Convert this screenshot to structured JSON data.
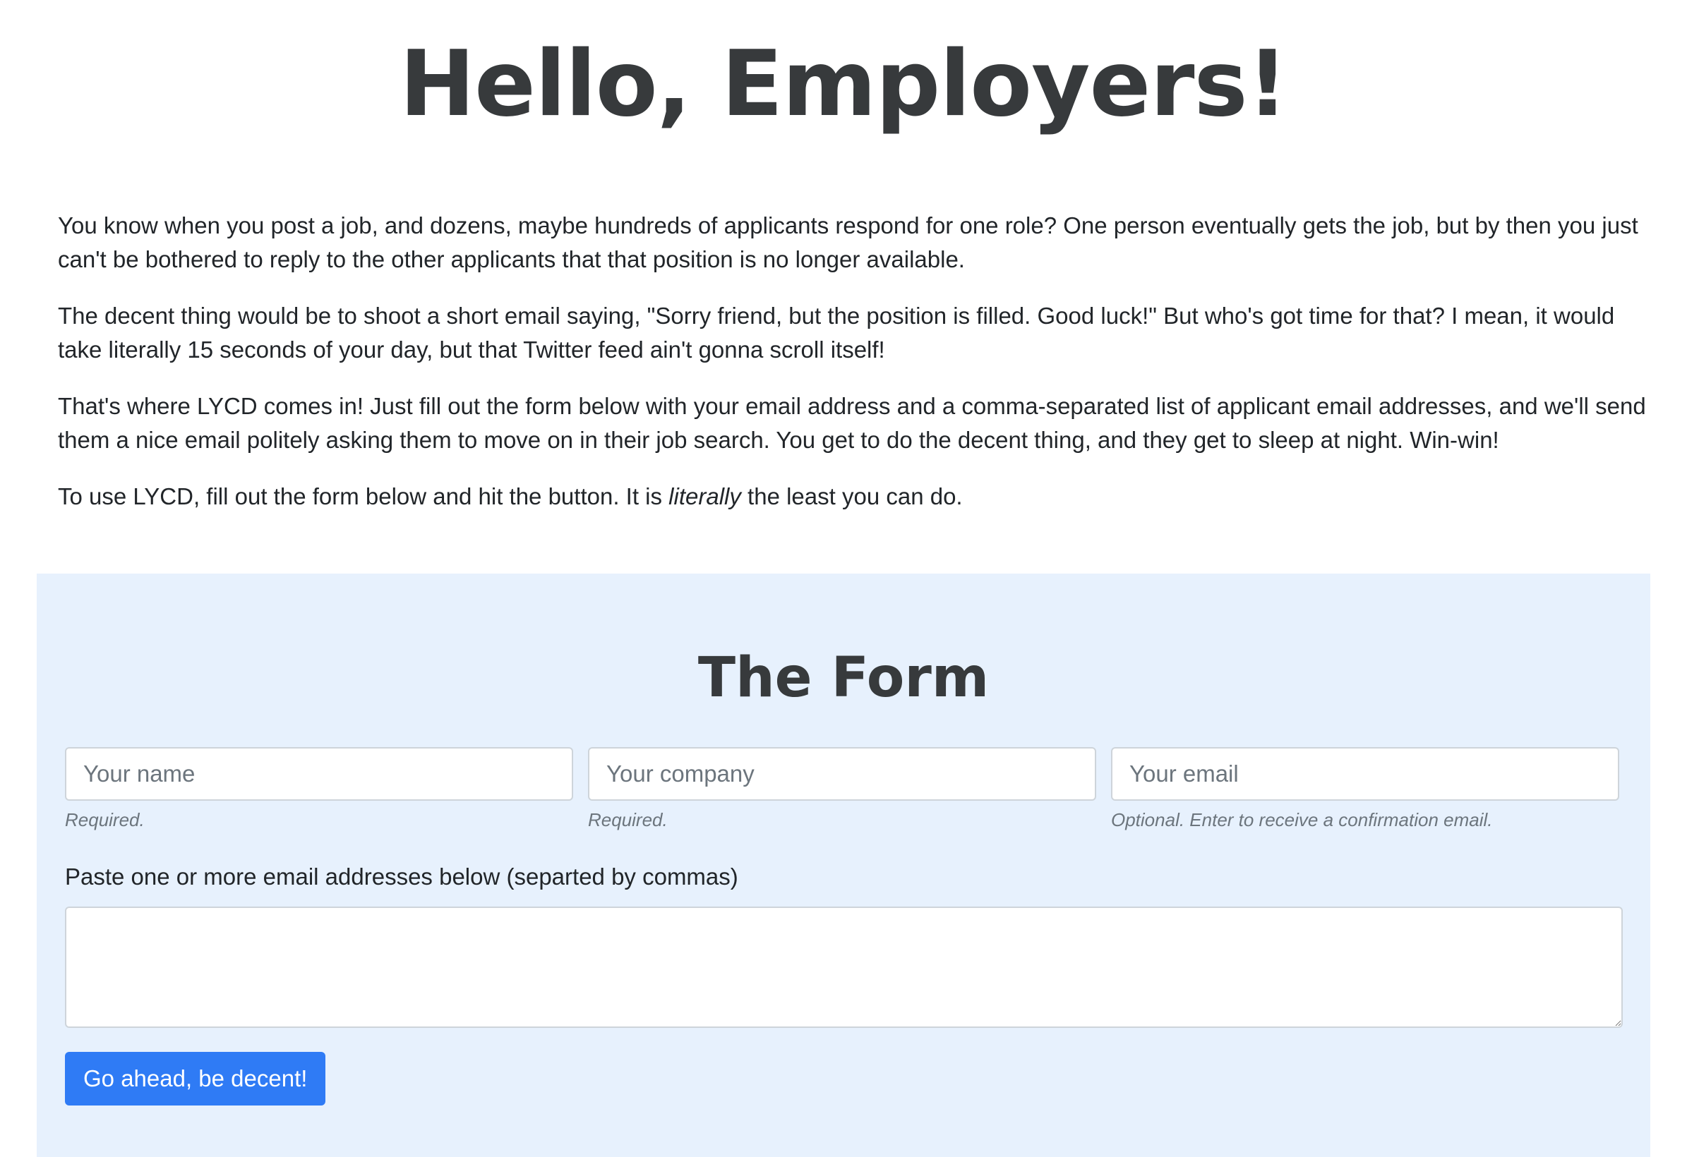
{
  "hero": {
    "title": "Hello, Employers!"
  },
  "intro": {
    "p1": "You know when you post a job, and dozens, maybe hundreds of applicants respond for one role? One person eventually gets the job, but by then you just can't be bothered to reply to the other applicants that that position is no longer available.",
    "p2": "The decent thing would be to shoot a short email saying, \"Sorry friend, but the position is filled. Good luck!\" But who's got time for that? I mean, it would take literally 15 seconds of your day, but that Twitter feed ain't gonna scroll itself!",
    "p3": "That's where LYCD comes in! Just fill out the form below with your email address and a comma-separated list of applicant email addresses, and we'll send them a nice email politely asking them to move on in their job search. You get to do the decent thing, and they get to sleep at night. Win-win!",
    "p4_before": "To use LYCD, fill out the form below and hit the button. It is ",
    "p4_emphasis": "literally",
    "p4_after": " the least you can do."
  },
  "form": {
    "title": "The Form",
    "name": {
      "placeholder": "Your name",
      "value": "",
      "help": "Required."
    },
    "company": {
      "placeholder": "Your company",
      "value": "",
      "help": "Required."
    },
    "email": {
      "placeholder": "Your email",
      "value": "",
      "help": "Optional. Enter to receive a confirmation email."
    },
    "emails_label": "Paste one or more email addresses below (separted by commas)",
    "emails_value": "",
    "submit_label": "Go ahead, be decent!"
  },
  "colors": {
    "panel_background": "#e7f1fd",
    "button_primary": "#2f7bf5",
    "heading": "#373a3c"
  }
}
